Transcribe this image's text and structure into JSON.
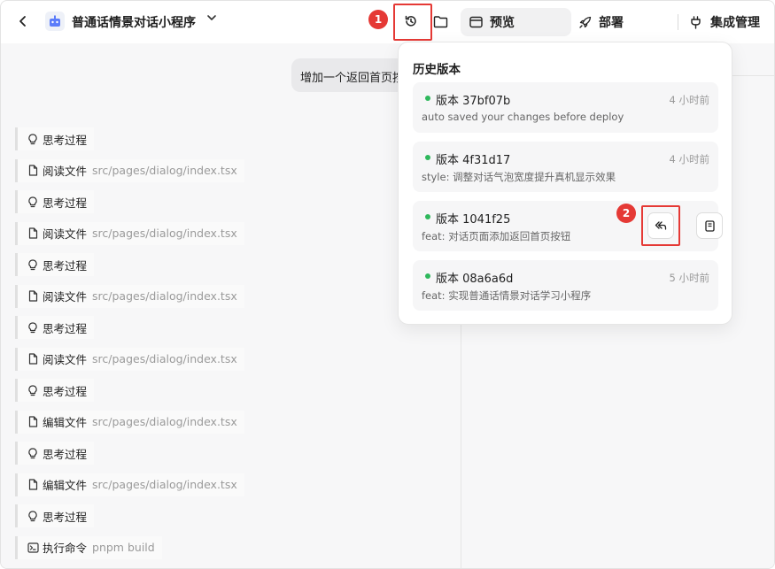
{
  "header": {
    "app_title": "普通话情景对话小程序",
    "tabs": {
      "preview": "预览",
      "deploy": "部署",
      "integration": "集成管理"
    }
  },
  "chat": {
    "user_message": "增加一个返回首页按钮",
    "steps": [
      {
        "label": "思考过程",
        "path": "",
        "icon": "lightbulb-icon"
      },
      {
        "label": "阅读文件",
        "path": "src/pages/dialog/index.tsx",
        "icon": "file-icon"
      },
      {
        "label": "思考过程",
        "path": "",
        "icon": "lightbulb-icon"
      },
      {
        "label": "阅读文件",
        "path": "src/pages/dialog/index.tsx",
        "icon": "file-icon"
      },
      {
        "label": "思考过程",
        "path": "",
        "icon": "lightbulb-icon"
      },
      {
        "label": "阅读文件",
        "path": "src/pages/dialog/index.tsx",
        "icon": "file-icon"
      },
      {
        "label": "思考过程",
        "path": "",
        "icon": "lightbulb-icon"
      },
      {
        "label": "阅读文件",
        "path": "src/pages/dialog/index.tsx",
        "icon": "file-icon"
      },
      {
        "label": "思考过程",
        "path": "",
        "icon": "lightbulb-icon"
      },
      {
        "label": "编辑文件",
        "path": "src/pages/dialog/index.tsx",
        "icon": "file-icon"
      },
      {
        "label": "思考过程",
        "path": "",
        "icon": "lightbulb-icon"
      },
      {
        "label": "编辑文件",
        "path": "src/pages/dialog/index.tsx",
        "icon": "file-icon"
      },
      {
        "label": "思考过程",
        "path": "",
        "icon": "lightbulb-icon"
      },
      {
        "label": "执行命令",
        "path": "pnpm build",
        "icon": "terminal-icon"
      }
    ]
  },
  "history": {
    "title": "历史版本",
    "versions": [
      {
        "name": "版本 37bf07b",
        "message": "auto saved your changes before deploy",
        "time": "4 小时前"
      },
      {
        "name": "版本 4f31d17",
        "message": "style: 调整对话气泡宽度提升真机显示效果",
        "time": "4 小时前"
      },
      {
        "name": "版本 1041f25",
        "message": "feat: 对话页面添加返回首页按钮",
        "time": ""
      },
      {
        "name": "版本 08a6a6d",
        "message": "feat: 实现普通话情景对话学习小程序",
        "time": "5 小时前"
      }
    ]
  },
  "annotations": {
    "badge_1": "1",
    "badge_2": "2"
  },
  "colors": {
    "highlight": "#e53935",
    "status_dot": "#2eb85c",
    "panel_bg": "#f7f7f8"
  }
}
